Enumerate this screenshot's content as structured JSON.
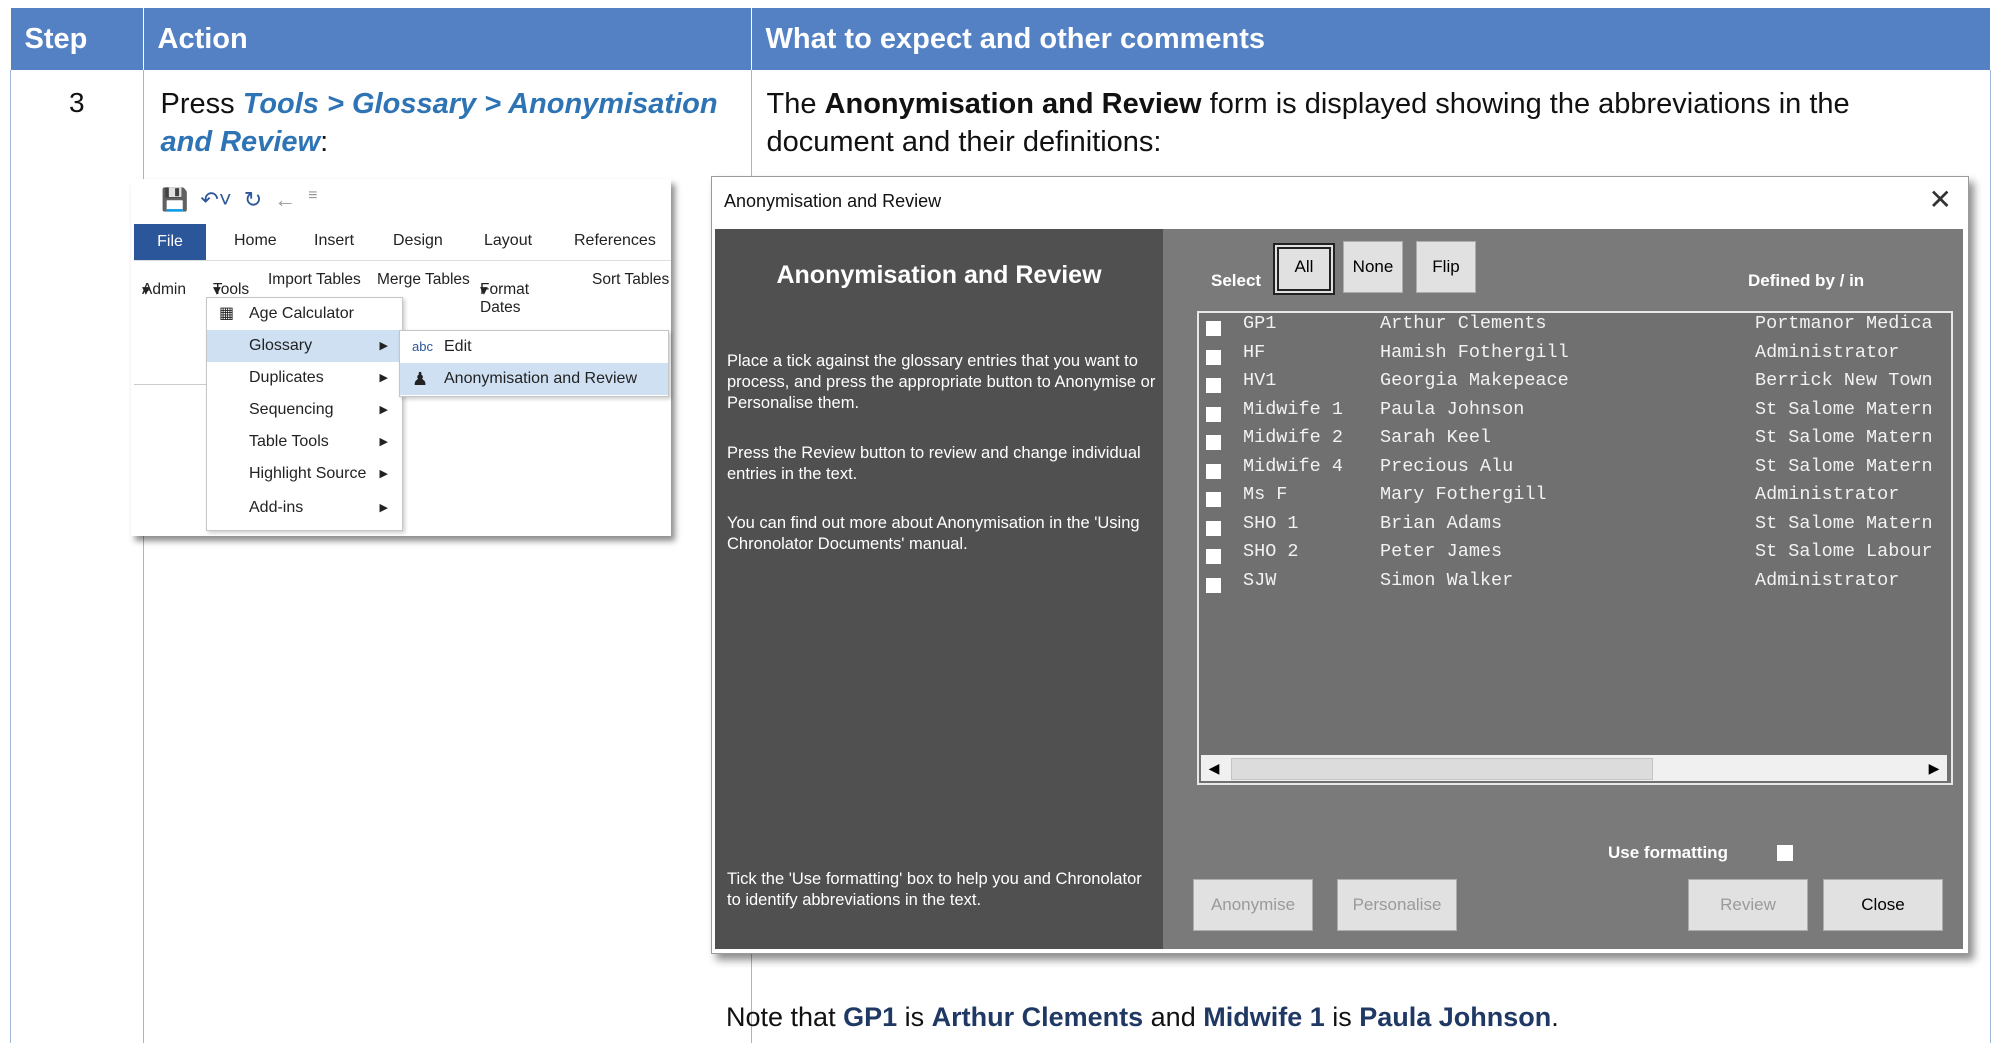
{
  "table": {
    "headers": [
      "Step",
      "Action",
      "What to expect and other comments"
    ],
    "step": "3",
    "action": {
      "prefix": "Press ",
      "link": "Tools > Glossary > Anonymisation and Review",
      "suffix": ":"
    },
    "comment": {
      "t1": "The ",
      "b1": "Anonymisation and Review",
      "t2": " form is displayed showing the abbreviations in the document and their definitions:"
    },
    "note": {
      "t1": "Note that ",
      "b1": "GP1",
      "t2": " is ",
      "b2": "Arthur Clements",
      "t3": " and ",
      "b3": "Midwife 1",
      "t4": " is ",
      "b4": "Paula Johnson",
      "t5": "."
    }
  },
  "ribbon": {
    "tabs": [
      "File",
      "Home",
      "Insert",
      "Design",
      "Layout",
      "References"
    ],
    "toolbar": [
      "Admin",
      "Tools",
      "Import Tables",
      "Merge Tables",
      "Format Dates",
      "Sort Tables"
    ],
    "menu": [
      "Age Calculator",
      "Glossary",
      "Duplicates",
      "Sequencing",
      "Table Tools",
      "Highlight Source",
      "Add-ins"
    ],
    "submenu": [
      "Edit",
      "Anonymisation and Review"
    ]
  },
  "dialog": {
    "title": "Anonymisation and Review",
    "heading": "Anonymisation and Review",
    "para1": "Place a tick against the glossary entries that you want to process, and press the appropriate button to Anonymise or Personalise them.",
    "para2": "Press the Review button to review and change individual entries in the text.",
    "para3": "You can find out more about Anonymisation in the 'Using Chronolator Documents' manual.",
    "para4": "Tick the 'Use formatting' box to help you and Chronolator to identify abbreviations in the text.",
    "select_label": "Select",
    "btn_all": "All",
    "btn_none": "None",
    "btn_flip": "Flip",
    "defined_by": "Defined by / in",
    "rows": [
      {
        "abbr": "GP1",
        "name": "Arthur Clements",
        "def": "Portmanor Medica"
      },
      {
        "abbr": "HF",
        "name": "Hamish Fothergill",
        "def": "Administrator"
      },
      {
        "abbr": "HV1",
        "name": "Georgia Makepeace",
        "def": "Berrick New Town"
      },
      {
        "abbr": "Midwife 1",
        "name": "Paula Johnson",
        "def": "St Salome Matern"
      },
      {
        "abbr": "Midwife 2",
        "name": "Sarah Keel",
        "def": "St Salome Matern"
      },
      {
        "abbr": "Midwife 4",
        "name": "Precious Alu",
        "def": "St Salome Matern"
      },
      {
        "abbr": "Ms F",
        "name": "Mary Fothergill",
        "def": "Administrator"
      },
      {
        "abbr": "SHO 1",
        "name": "Brian Adams",
        "def": "St Salome Matern"
      },
      {
        "abbr": "SHO 2",
        "name": "Peter James",
        "def": "St Salome Labour"
      },
      {
        "abbr": "SJW",
        "name": "Simon Walker",
        "def": "Administrator"
      }
    ],
    "use_formatting": "Use formatting",
    "btn_anonymise": "Anonymise",
    "btn_personalise": "Personalise",
    "btn_review": "Review",
    "btn_close": "Close"
  }
}
